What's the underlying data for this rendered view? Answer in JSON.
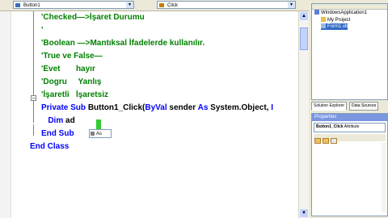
{
  "editor": {
    "class_combo": "Button1",
    "method_combo": "Click",
    "lines": [
      {
        "segments": [
          {
            "t": "'Checked—>İşaret Durumu",
            "c": "cm"
          }
        ]
      },
      {
        "segments": [
          {
            "t": "'",
            "c": "cm"
          }
        ]
      },
      {
        "segments": [
          {
            "t": "'Boolean —>Mantıksal İfadelerde kullanılır.",
            "c": "cm"
          }
        ]
      },
      {
        "segments": [
          {
            "t": "'True ve False—",
            "c": "cm"
          }
        ]
      },
      {
        "segments": [
          {
            "t": "'Evet       hayır",
            "c": "cm"
          }
        ]
      },
      {
        "segments": [
          {
            "t": "'Dogru     Yanlış",
            "c": "cm"
          }
        ]
      },
      {
        "segments": [
          {
            "t": "'İşaretli   İşaretsiz",
            "c": "cm"
          }
        ]
      },
      {
        "segments": [
          {
            "t": "Private ",
            "c": "kw"
          },
          {
            "t": "Sub ",
            "c": "kw"
          },
          {
            "t": "Button1_Click(",
            "c": "tx"
          },
          {
            "t": "ByVal ",
            "c": "kw"
          },
          {
            "t": "sender ",
            "c": "tx"
          },
          {
            "t": "As ",
            "c": "kw"
          },
          {
            "t": "System.Object, ",
            "c": "tx"
          },
          {
            "t": "I",
            "c": "kw"
          }
        ]
      },
      {
        "segments": [
          {
            "t": "   Dim ",
            "c": "kw"
          },
          {
            "t": "ad",
            "c": "tx"
          }
        ]
      },
      {
        "segments": [
          {
            "t": "End ",
            "c": "kw"
          },
          {
            "t": "Sub",
            "c": "kw"
          }
        ]
      },
      {
        "segments": [
          {
            "t": "End ",
            "c": "kw"
          },
          {
            "t": "Class",
            "c": "kw"
          }
        ]
      }
    ],
    "intellisense": "As"
  },
  "solution_explorer": {
    "items": [
      {
        "label": "WindowsApplication1",
        "icon": "project-icon"
      },
      {
        "label": "My Project",
        "icon": "folder-icon"
      },
      {
        "label": "Form1.vb",
        "icon": "form-file-icon"
      }
    ],
    "tabs": [
      "Solution Explorer",
      "Data Sources"
    ]
  },
  "properties": {
    "title": "Properties",
    "object": "Button1_Click",
    "object_type": "Attribute"
  },
  "colors": {
    "keyword": "#0000ff",
    "comment": "#008000",
    "panel": "#ece9d8"
  }
}
